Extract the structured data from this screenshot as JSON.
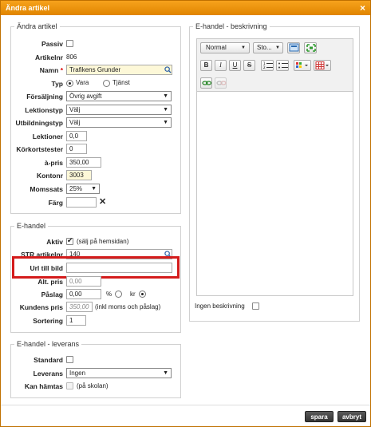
{
  "dialog": {
    "title": "Ändra artikel",
    "close_label": "×"
  },
  "article": {
    "legend": "Ändra artikel",
    "passiv_label": "Passiv",
    "artikelnr_label": "Artikelnr",
    "artikelnr_value": "806",
    "namn_label": "Namn",
    "namn_required": "*",
    "namn_value": "Trafikens Grunder",
    "typ_label": "Typ",
    "typ_options": [
      "Vara",
      "Tjänst"
    ],
    "forsaljning_label": "Försäljning",
    "forsaljning_value": "Övrig avgift",
    "lektionstyp_label": "Lektionstyp",
    "lektionstyp_value": "Välj",
    "utbildningstyp_label": "Utbildningstyp",
    "utbildningstyp_value": "Välj",
    "lektioner_label": "Lektioner",
    "lektioner_value": "0,0",
    "korkortstester_label": "Körkortstester",
    "korkortstester_value": "0",
    "apris_label": "à-pris",
    "apris_value": "350,00",
    "kontonr_label": "Kontonr",
    "kontonr_value": "3003",
    "momssats_label": "Momssats",
    "momssats_value": "25%",
    "farg_label": "Färg",
    "farg_clear": "✕"
  },
  "ehandel": {
    "legend": "E-handel",
    "aktiv_label": "Aktiv",
    "aktiv_note": "(sälj på hemsidan)",
    "str_label": "STR artikelnr",
    "str_value": "140",
    "url_label": "Url till bild",
    "url_value": "",
    "altpris_label": "Alt. pris",
    "altpris_value": "0,00",
    "paslag_label": "Påslag",
    "paslag_value": "0,00",
    "paslag_unit1": "%",
    "paslag_unit2": "kr",
    "kundens_label": "Kundens pris",
    "kundens_value": "350,00",
    "kundens_note": "(inkl moms och påslag)",
    "sortering_label": "Sortering",
    "sortering_value": "1"
  },
  "leverans": {
    "legend": "E-handel - leverans",
    "standard_label": "Standard",
    "leverans_label": "Leverans",
    "leverans_value": "Ingen",
    "kanhamtas_label": "Kan hämtas",
    "kanhamtas_note": "(på skolan)"
  },
  "beskrivning": {
    "legend": "E-handel - beskrivning",
    "format_value": "Normal",
    "size_value": "Sto...",
    "bold": "B",
    "italic": "I",
    "underline": "U",
    "strike": "S",
    "ingen_label": "Ingen beskrivning"
  },
  "footer": {
    "save_label": "spara",
    "cancel_label": "avbryt"
  },
  "colors": {
    "title_orange": "#f39200",
    "highlight_red": "#d41c1c",
    "field_yellow": "#fdf8d8"
  }
}
